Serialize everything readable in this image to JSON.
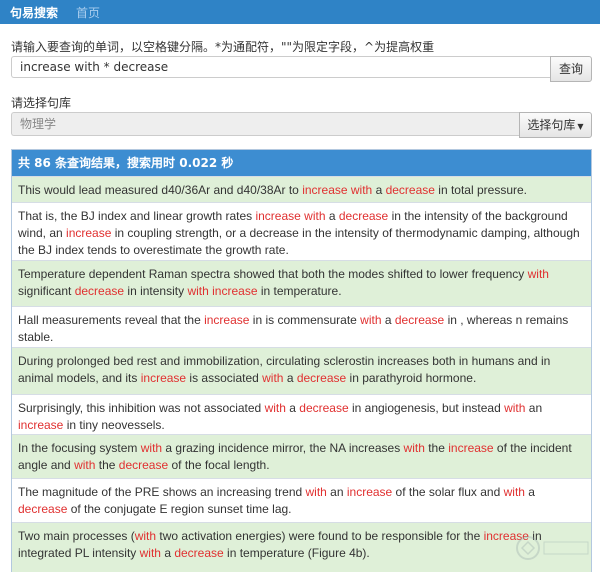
{
  "nav": {
    "items": [
      {
        "label": "句易搜索",
        "active": true
      },
      {
        "label": "首页",
        "active": false
      }
    ]
  },
  "search": {
    "hint": "请输入要查询的单词，以空格键分隔。*为通配符，\"\"为限定字段，^为提高权重",
    "value": "increase with * decrease",
    "button_label": "查询"
  },
  "library": {
    "label": "请选择句库",
    "placeholder": "物理学",
    "button_label": "选择句库"
  },
  "results": {
    "summary": "共 86 条查询结果，搜索用时 0.022 秒",
    "highlight_color": "#e03030",
    "row_colors": [
      "#dff0d8",
      "#ffffff"
    ],
    "items": [
      {
        "height": 26,
        "segments": [
          {
            "t": "This would lead measured d40/36Ar and d40/38Ar to "
          },
          {
            "t": "increase",
            "hl": true
          },
          {
            "t": " "
          },
          {
            "t": "with",
            "hl": true
          },
          {
            "t": " a "
          },
          {
            "t": "decrease",
            "hl": true
          },
          {
            "t": " in total pressure."
          }
        ]
      },
      {
        "height": 58,
        "segments": [
          {
            "t": "That is, the BJ index and linear growth rates "
          },
          {
            "t": "increase",
            "hl": true
          },
          {
            "t": " "
          },
          {
            "t": "with",
            "hl": true
          },
          {
            "t": " a "
          },
          {
            "t": "decrease",
            "hl": true
          },
          {
            "t": " in the intensity of the background wind, an "
          },
          {
            "t": "increase",
            "hl": true
          },
          {
            "t": " in coupling strength, or a decrease in the intensity of thermodynamic damping, although the BJ index tends to overestimate the growth rate."
          }
        ]
      },
      {
        "height": 46,
        "segments": [
          {
            "t": "Temperature dependent Raman spectra showed that both the modes shifted to lower frequency "
          },
          {
            "t": "with",
            "hl": true
          },
          {
            "t": " significant "
          },
          {
            "t": "decrease",
            "hl": true
          },
          {
            "t": " in intensity "
          },
          {
            "t": "with",
            "hl": true
          },
          {
            "t": " "
          },
          {
            "t": "increase",
            "hl": true
          },
          {
            "t": " in temperature."
          }
        ]
      },
      {
        "height": 41,
        "segments": [
          {
            "t": "Hall measurements reveal that the "
          },
          {
            "t": "increase",
            "hl": true
          },
          {
            "t": " in is commensurate "
          },
          {
            "t": "with",
            "hl": true
          },
          {
            "t": " a "
          },
          {
            "t": "decrease",
            "hl": true
          },
          {
            "t": " in , whereas n remains stable."
          }
        ]
      },
      {
        "height": 47,
        "segments": [
          {
            "t": "During prolonged bed rest and immobilization, circulating sclerostin increases both in humans and in animal models, and its "
          },
          {
            "t": "increase",
            "hl": true
          },
          {
            "t": " is associated "
          },
          {
            "t": "with",
            "hl": true
          },
          {
            "t": " a "
          },
          {
            "t": "decrease",
            "hl": true
          },
          {
            "t": " in parathyroid hormone."
          }
        ]
      },
      {
        "height": 40,
        "segments": [
          {
            "t": "Surprisingly, this inhibition was not associated "
          },
          {
            "t": "with",
            "hl": true
          },
          {
            "t": " a "
          },
          {
            "t": "decrease",
            "hl": true
          },
          {
            "t": " in angiogenesis, but instead "
          },
          {
            "t": "with",
            "hl": true
          },
          {
            "t": " an "
          },
          {
            "t": "increase",
            "hl": true
          },
          {
            "t": " in tiny neovessels."
          }
        ]
      },
      {
        "height": 44,
        "segments": [
          {
            "t": "In the focusing system "
          },
          {
            "t": "with",
            "hl": true
          },
          {
            "t": " a grazing incidence mirror, the NA increases "
          },
          {
            "t": "with",
            "hl": true
          },
          {
            "t": " the "
          },
          {
            "t": "increase",
            "hl": true
          },
          {
            "t": " of the incident angle and "
          },
          {
            "t": "with",
            "hl": true
          },
          {
            "t": " the "
          },
          {
            "t": "decrease",
            "hl": true
          },
          {
            "t": " of the focal length."
          }
        ]
      },
      {
        "height": 44,
        "segments": [
          {
            "t": "The magnitude of the PRE shows an increasing trend "
          },
          {
            "t": "with",
            "hl": true
          },
          {
            "t": " an "
          },
          {
            "t": "increase",
            "hl": true
          },
          {
            "t": " of the solar flux and "
          },
          {
            "t": "with",
            "hl": true
          },
          {
            "t": " a "
          },
          {
            "t": "decrease",
            "hl": true
          },
          {
            "t": " of the conjugate E region sunset time lag."
          }
        ]
      },
      {
        "height": 50,
        "segments": [
          {
            "t": "Two main processes ("
          },
          {
            "t": "with",
            "hl": true
          },
          {
            "t": " two activation energies) were found to be responsible for the "
          },
          {
            "t": "increase",
            "hl": true
          },
          {
            "t": " in integrated PL intensity "
          },
          {
            "t": "with",
            "hl": true
          },
          {
            "t": " a "
          },
          {
            "t": "decrease",
            "hl": true
          },
          {
            "t": " in temperature (Figure 4b)."
          }
        ]
      }
    ]
  }
}
